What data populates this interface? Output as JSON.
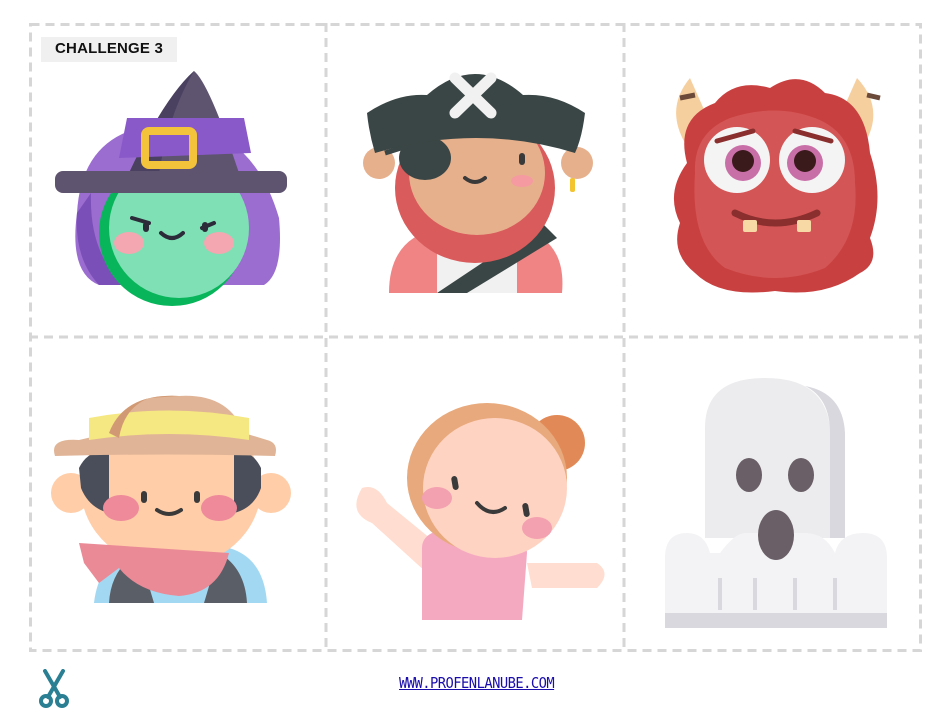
{
  "title": "CHALLENGE 3",
  "website": "WWW.PROFENLANUBE.COM",
  "cells": [
    {
      "character": "witch"
    },
    {
      "character": "pirate"
    },
    {
      "character": "monster"
    },
    {
      "character": "cowboy"
    },
    {
      "character": "dancer"
    },
    {
      "character": "ghost"
    }
  ],
  "icons": {
    "cut_marker": "scissors-icon"
  },
  "colors": {
    "border": "#d6d6d6",
    "link": "#1a0dab",
    "scissors": "#2a7f93"
  }
}
